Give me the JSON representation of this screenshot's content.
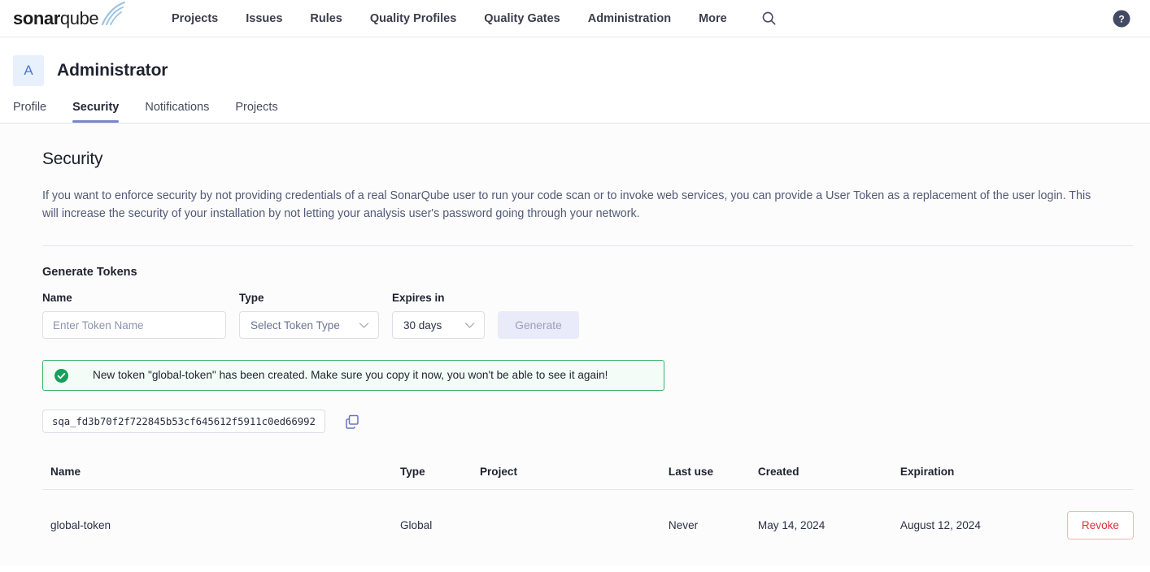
{
  "topnav": {
    "logo": {
      "bold": "sonar",
      "light": "qube",
      "icon": "sonarqube-logo"
    },
    "items": [
      {
        "label": "Projects",
        "name": "nav-item-projects"
      },
      {
        "label": "Issues",
        "name": "nav-item-issues"
      },
      {
        "label": "Rules",
        "name": "nav-item-rules"
      },
      {
        "label": "Quality Profiles",
        "name": "nav-item-quality-profiles"
      },
      {
        "label": "Quality Gates",
        "name": "nav-item-quality-gates"
      },
      {
        "label": "Administration",
        "name": "nav-item-administration"
      },
      {
        "label": "More",
        "name": "nav-item-more"
      }
    ],
    "search_icon": "search-icon",
    "help_icon": "help-circle-icon"
  },
  "user_header": {
    "avatar_initial": "A",
    "user_name": "Administrator",
    "tabs": [
      {
        "label": "Profile",
        "name": "tab-profile",
        "active": false
      },
      {
        "label": "Security",
        "name": "tab-security",
        "active": true
      },
      {
        "label": "Notifications",
        "name": "tab-notifications",
        "active": false
      },
      {
        "label": "Projects",
        "name": "tab-projects",
        "active": false
      }
    ],
    "active_tab_color": "#7a86cb"
  },
  "main": {
    "title": "Security",
    "description": "If you want to enforce security by not providing credentials of a real SonarQube user to run your code scan or to invoke web services, you can provide a User Token as a replacement of the user login. This will increase the security of your installation by not letting your analysis user's password going through your network.",
    "generate_section": {
      "heading": "Generate Tokens",
      "name_label": "Name",
      "name_placeholder": "Enter Token Name",
      "name_value": "",
      "type_label": "Type",
      "type_value": "Select Token Type",
      "expires_label": "Expires in",
      "expires_value": "30 days",
      "generate_button": "Generate",
      "generate_disabled": true
    },
    "alert": {
      "icon": "check-circle-icon",
      "message": "New token \"global-token\" has been created. Make sure you copy it now, you won't be able to see it again!",
      "border_color": "#3fb46a"
    },
    "token": {
      "value": "sqa_fd3b70f2f722845b53cf645612f5911c0ed66992",
      "copy_icon": "copy-icon"
    },
    "table": {
      "headers": [
        "Name",
        "Type",
        "Project",
        "Last use",
        "Created",
        "Expiration",
        ""
      ],
      "rows": [
        {
          "name": "global-token",
          "type": "Global",
          "project": "",
          "last_use": "Never",
          "created": "May 14, 2024",
          "expiration": "August 12, 2024",
          "action_label": "Revoke",
          "action_color": "#d4333f"
        }
      ]
    }
  }
}
